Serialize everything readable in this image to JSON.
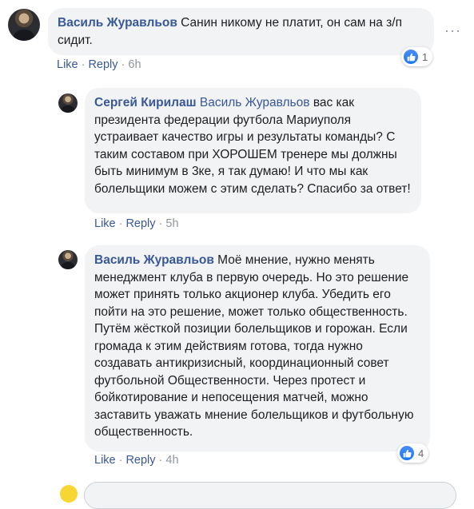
{
  "comments": [
    {
      "author": "Василь Журавльов",
      "text": "Санин никому не платит, он сам на з/п сидит.",
      "actions": {
        "like": "Like",
        "reply": "Reply",
        "time": "6h"
      },
      "reaction_count": "1"
    },
    {
      "author": "Сергей Кирилаш",
      "mention": "Василь Журавльов",
      "text": "вас как президента федерации футбола Мариуполя устраивает качество игры и результаты команды? С таким составом при ХОРОШЕМ тренере мы должны быть минимум в 3ке, я так думаю! И что мы как болельщики можем с этим сделать? Спасибо за ответ!",
      "actions": {
        "like": "Like",
        "reply": "Reply",
        "time": "5h"
      }
    },
    {
      "author": "Василь Журавльов",
      "text": "Моё мнение, нужно менять менеджмент клуба в первую очередь. Но это решение может принять только акционер клуба. Убедить его пойти на это решение, может только общественность. Путём жёсткой позиции болельщиков и горожан. Если громада к этим действиям готова, тогда нужно создавать антикризисный, координационный совет футбольной Общественности. Через протест и бойкотирование и непосещения матчей, можно заставить уважать мнение болельщиков и футбольную общественность.",
      "actions": {
        "like": "Like",
        "reply": "Reply",
        "time": "4h"
      },
      "reaction_count": "4"
    }
  ],
  "more_label": "···",
  "dot": "·"
}
